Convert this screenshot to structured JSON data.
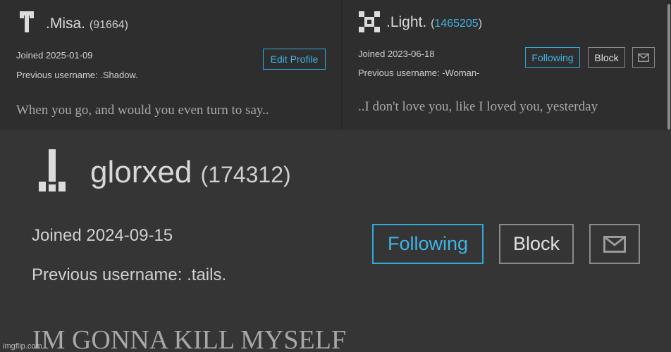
{
  "profiles": [
    {
      "display_name": ".Misa.",
      "score": "(91664)",
      "joined": "Joined 2025-01-09",
      "previous_username": "Previous username: .Shadow.",
      "bio": "When you go, and would you even turn to say..",
      "edit_profile_label": "Edit Profile"
    },
    {
      "display_name": ".Light.",
      "score_open": "(",
      "score_value": "1465205",
      "score_close": ")",
      "joined": "Joined 2023-06-18",
      "previous_username": "Previous username: -Woman-",
      "bio": "..I don't love you, like I loved you, yesterday",
      "following_label": "Following",
      "block_label": "Block",
      "message_icon": "envelope-icon"
    },
    {
      "display_name": "glorxed",
      "score": "(174312)",
      "joined": "Joined 2024-09-15",
      "previous_username": "Previous username: .tails.",
      "bio": "IM GONNA KILL MYSELF",
      "following_label": "Following",
      "block_label": "Block",
      "message_icon": "envelope-icon"
    }
  ],
  "watermark": "imgflip.com",
  "colors": {
    "background": "#2b2b2b",
    "accent": "#3fb4e6",
    "text": "#d8d8d8",
    "bio_text": "#a8a8a8"
  }
}
